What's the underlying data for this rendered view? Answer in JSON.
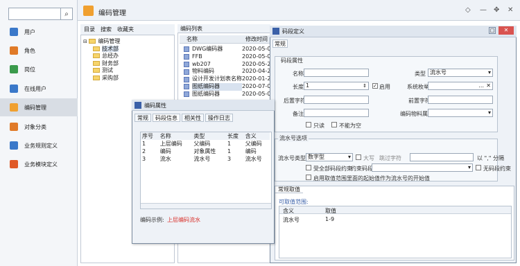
{
  "sidebar": {
    "search": {
      "placeholder": ""
    },
    "items": [
      {
        "label": "用户",
        "icon": "user-icon",
        "color": "#3a78c9"
      },
      {
        "label": "角色",
        "icon": "role-icon",
        "color": "#e07a28"
      },
      {
        "label": "岗位",
        "icon": "post-icon",
        "color": "#3a9a4c"
      },
      {
        "label": "在线用户",
        "icon": "online-user-icon",
        "color": "#3a78c9"
      },
      {
        "label": "编码管理",
        "icon": "code-manage-icon",
        "color": "#f0a030"
      },
      {
        "label": "对象分类",
        "icon": "category-icon",
        "color": "#e07a28"
      },
      {
        "label": "业务规则定义",
        "icon": "rule-icon",
        "color": "#3a78c9"
      },
      {
        "label": "业务模块定义",
        "icon": "module-icon",
        "color": "#e05a28"
      }
    ]
  },
  "header": {
    "title": "编码管理",
    "controls": [
      "◇",
      "—",
      "✥",
      "✕"
    ]
  },
  "left_panel": {
    "tabs": [
      "目录",
      "搜索",
      "收藏夹"
    ],
    "tree": {
      "root": "编码管理",
      "children": [
        "技术部",
        "总经办",
        "财务部",
        "测试",
        "采购部"
      ]
    }
  },
  "list_panel": {
    "tab": "编码列表",
    "columns": [
      "名称",
      "修改时间"
    ],
    "rows": [
      {
        "name": "DWG编码器",
        "time": "2020-05-04"
      },
      {
        "name": "FFB",
        "time": "2020-05-06"
      },
      {
        "name": "wb207",
        "time": "2020-05-25"
      },
      {
        "name": "物料编码",
        "time": "2020-04-20"
      },
      {
        "name": "设计开发计划表名称...",
        "time": "2020-01-21"
      },
      {
        "name": "图纸编码器",
        "time": "2020-07-06"
      },
      {
        "name": "图纸编码器",
        "time": "2020-05-07"
      }
    ]
  },
  "define_dialog": {
    "title": "码段定义",
    "tab": "常规",
    "group1": "码段属性",
    "name_label": "名称",
    "type_label": "类型",
    "type_value": "流水号",
    "length_label": "长度",
    "length_value": "1",
    "enable_label": "启用",
    "field_label": "系统枚举",
    "field_value": "...",
    "suffix_label": "后置字符",
    "prefix_label": "前置字符",
    "remark_label": "备注",
    "material_label": "编码物料属性",
    "readonly_label": "只读",
    "notnull_label": "不能为空",
    "group2": "流水号选项",
    "serial_type_label": "流水号类型",
    "serial_type_value": "数字型",
    "uppercase_label": "大写",
    "skip_label": "跳过字符",
    "separator_hint": "以 \",\" 分隔",
    "all_constraint_label": "受全部码段约束",
    "constraint_label": "约束码段",
    "no_constraint_label": "无码段约束",
    "start_value_label": "启用取值范围里面的起始值作为流水号的开始值",
    "group3_tab": "常规取值",
    "range_label": "可取值范围:",
    "range_columns": [
      "含义",
      "取值"
    ],
    "range_rows": [
      {
        "meaning": "流水号",
        "value": "1-9"
      }
    ]
  },
  "attr_dialog": {
    "title": "编码属性",
    "tabs": [
      "常规",
      "码段信息",
      "相关性",
      "操作日志"
    ],
    "columns": [
      "序号",
      "名称",
      "类型",
      "长度",
      "含义"
    ],
    "rows": [
      {
        "no": "1",
        "name": "上层编码",
        "type": "父编码",
        "len": "1",
        "meaning": "父编码"
      },
      {
        "no": "2",
        "name": "编码",
        "type": "对象属性",
        "len": "1",
        "meaning": "编码"
      },
      {
        "no": "3",
        "name": "流水",
        "type": "流水号",
        "len": "3",
        "meaning": "流水号"
      }
    ],
    "example_label": "编码示例:",
    "example_value": "上层编码流水"
  }
}
